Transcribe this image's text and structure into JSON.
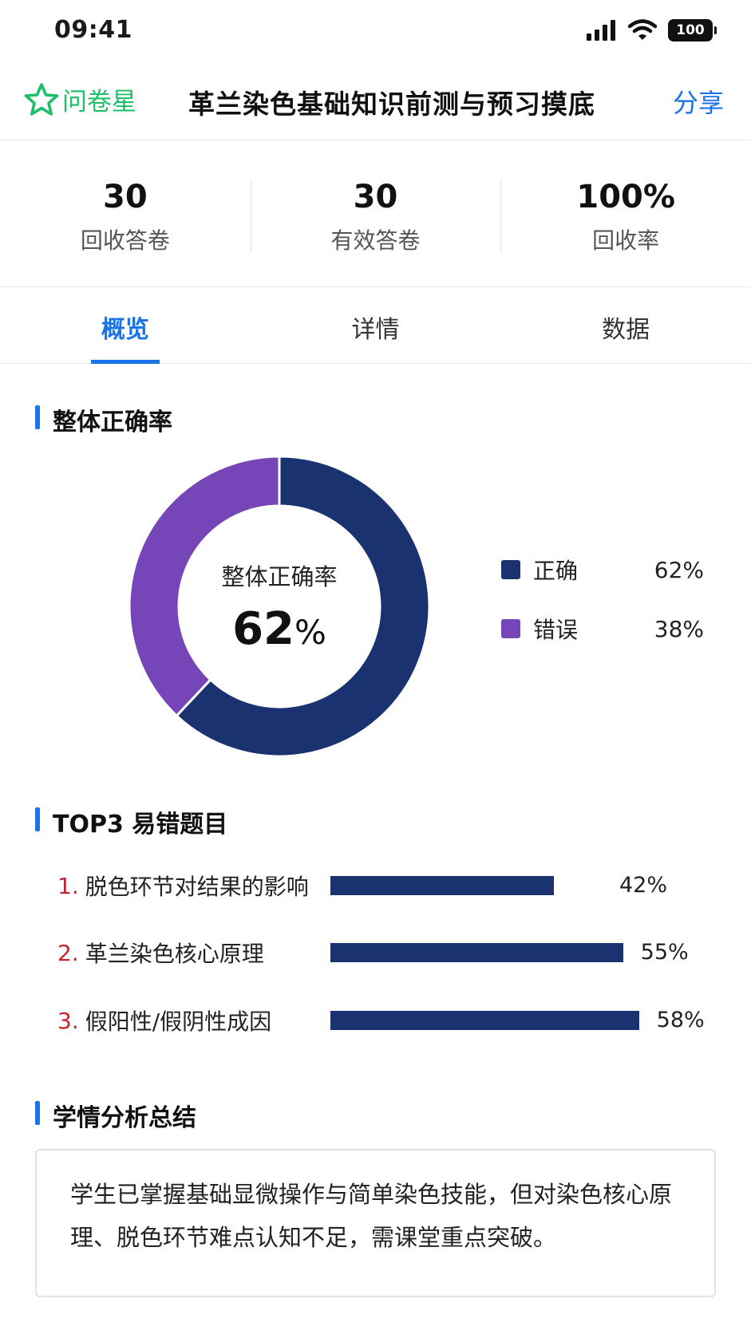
{
  "status": {
    "time": "09:41",
    "battery": "100"
  },
  "header": {
    "brand": "问卷星",
    "title": "革兰染色基础知识前测与预习摸底",
    "share": "分享"
  },
  "stats": [
    {
      "value": "30",
      "label": "回收答卷"
    },
    {
      "value": "30",
      "label": "有效答卷"
    },
    {
      "value": "100%",
      "label": "回收率"
    }
  ],
  "tabs": [
    {
      "label": "概览",
      "active": true
    },
    {
      "label": "详情",
      "active": false
    },
    {
      "label": "数据",
      "active": false
    }
  ],
  "sections": {
    "overall": "整体正确率",
    "top3": "TOP3 易错题目",
    "summary": "学情分析总结"
  },
  "chart_data": [
    {
      "type": "pie",
      "title": "整体正确率",
      "center_label": "整体正确率",
      "center_value": "62",
      "center_unit": "%",
      "categories": [
        "正确",
        "错误"
      ],
      "values": [
        62,
        38
      ],
      "value_labels": [
        "62%",
        "38%"
      ],
      "colors": [
        "#1a3370",
        "#7646b8"
      ],
      "legend": "right"
    },
    {
      "type": "bar",
      "title": "TOP3 易错题目",
      "ranks": [
        "1.",
        "2.",
        "3."
      ],
      "categories": [
        "脱色环节对结果的影响",
        "革兰染色核心原理",
        "假阳性/假阴性成因"
      ],
      "values": [
        42,
        55,
        58
      ],
      "value_labels": [
        "42%",
        "55%",
        "58%"
      ],
      "color": "#1a3370"
    }
  ],
  "summary_text": "学生已掌握基础显微操作与简单染色技能，但对染色核心原理、脱色环节难点认知不足，需课堂重点突破。"
}
